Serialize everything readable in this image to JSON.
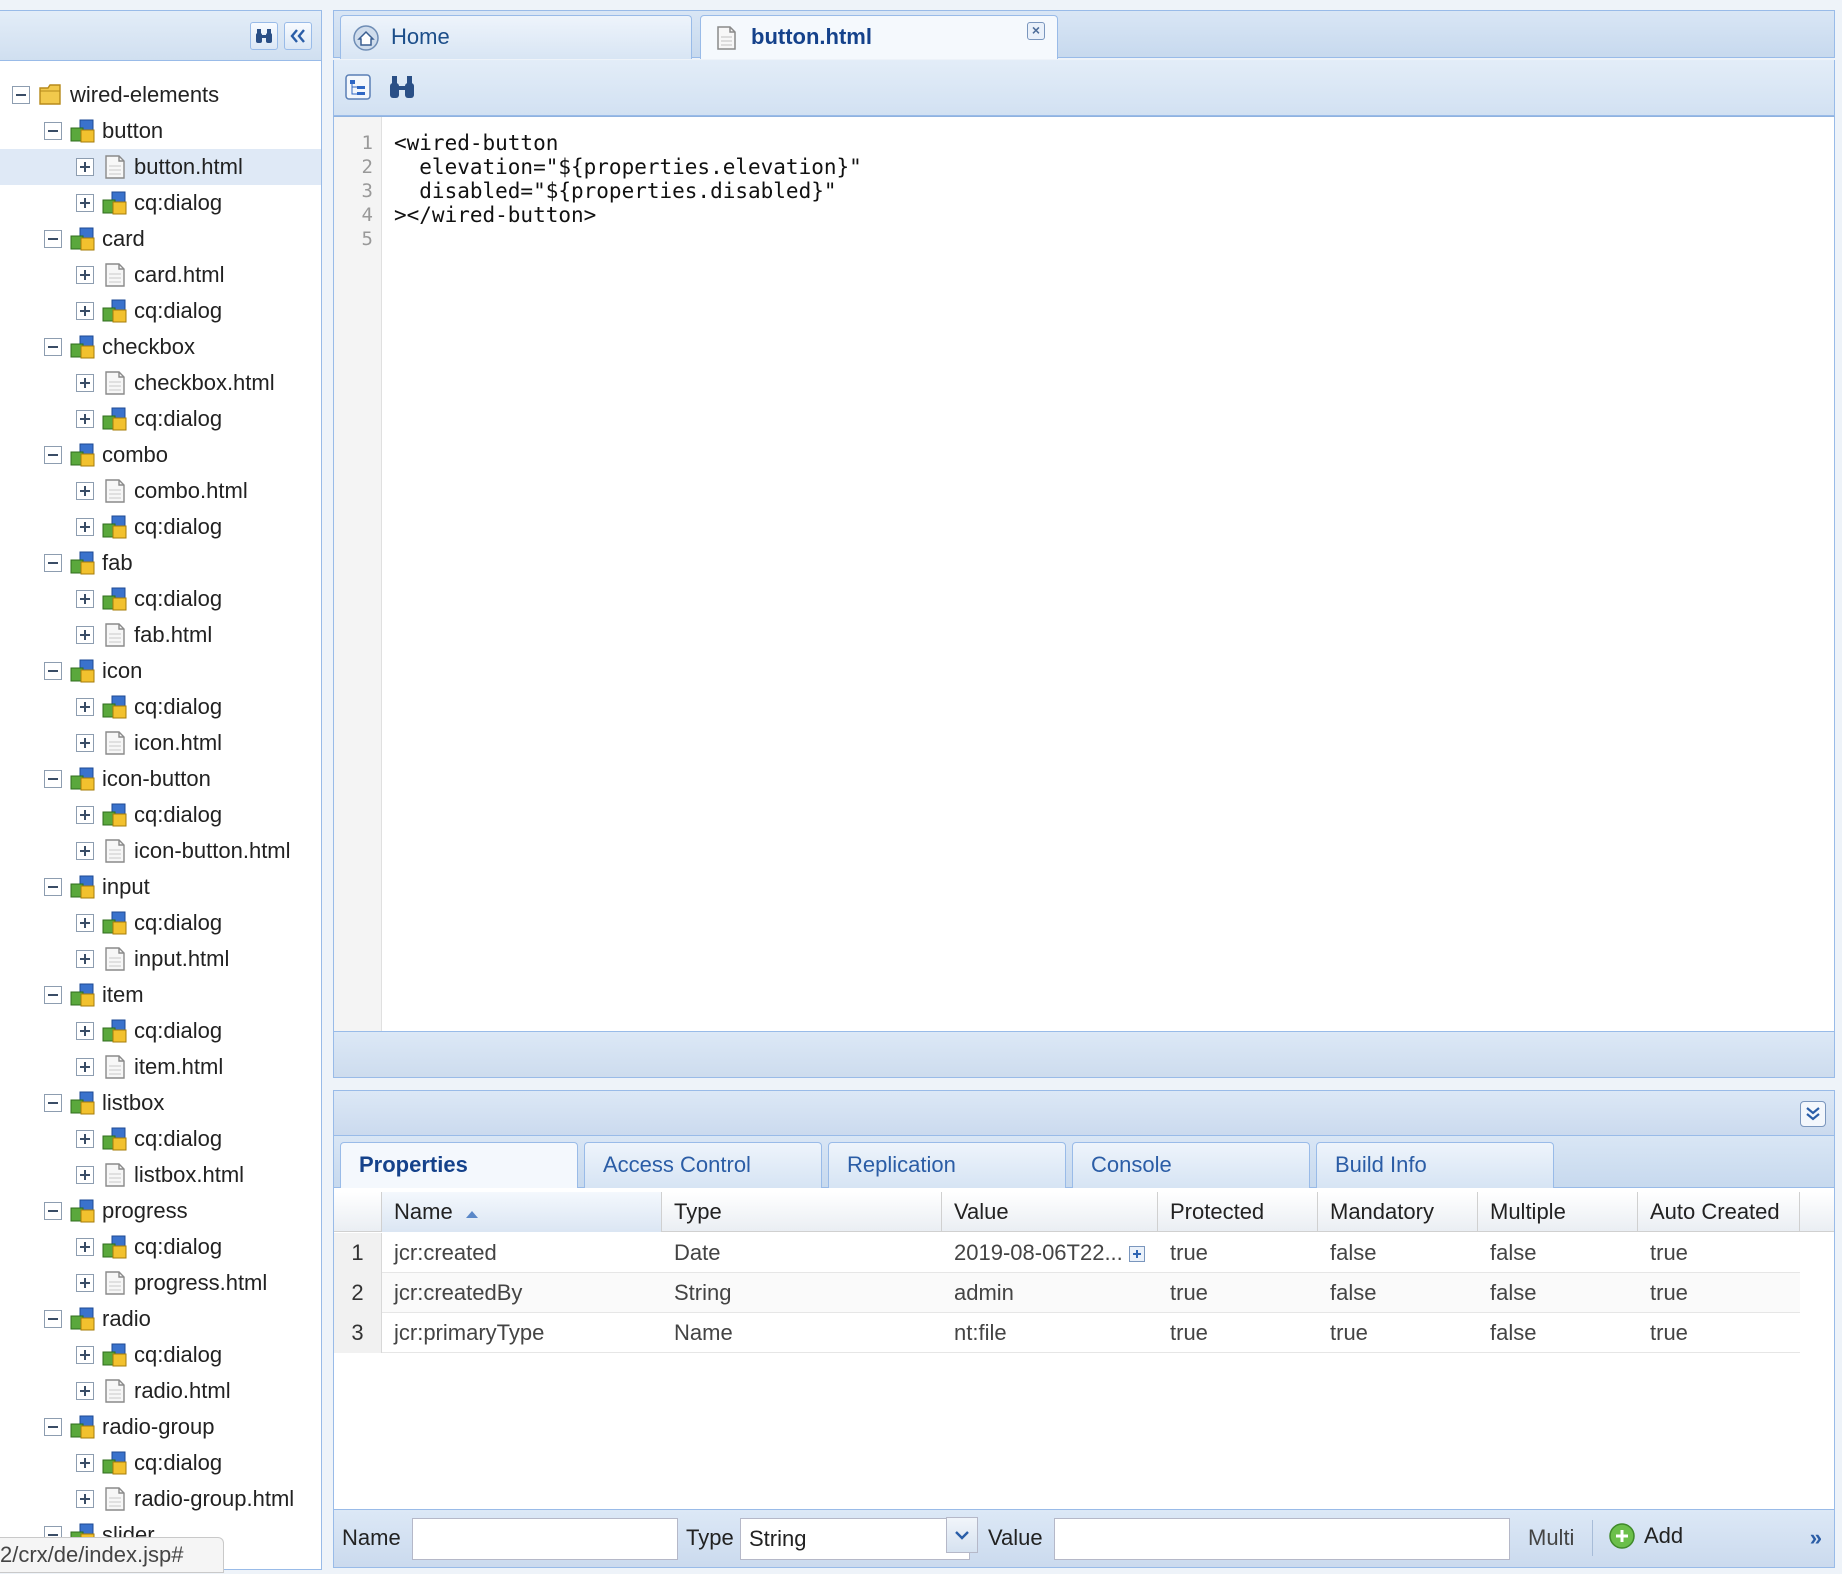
{
  "tree": {
    "items": [
      {
        "label": "wired-elements",
        "level": 0,
        "toggle": "minus",
        "icon": "folder-icon"
      },
      {
        "label": "button",
        "level": 1,
        "toggle": "minus",
        "icon": "component-icon"
      },
      {
        "label": "button.html",
        "level": 2,
        "toggle": "plus",
        "icon": "file-icon",
        "selected": true
      },
      {
        "label": "cq:dialog",
        "level": 2,
        "toggle": "plus",
        "icon": "component-icon"
      },
      {
        "label": "card",
        "level": 1,
        "toggle": "minus",
        "icon": "component-icon"
      },
      {
        "label": "card.html",
        "level": 2,
        "toggle": "plus",
        "icon": "file-icon"
      },
      {
        "label": "cq:dialog",
        "level": 2,
        "toggle": "plus",
        "icon": "component-icon"
      },
      {
        "label": "checkbox",
        "level": 1,
        "toggle": "minus",
        "icon": "component-icon"
      },
      {
        "label": "checkbox.html",
        "level": 2,
        "toggle": "plus",
        "icon": "file-icon"
      },
      {
        "label": "cq:dialog",
        "level": 2,
        "toggle": "plus",
        "icon": "component-icon"
      },
      {
        "label": "combo",
        "level": 1,
        "toggle": "minus",
        "icon": "component-icon"
      },
      {
        "label": "combo.html",
        "level": 2,
        "toggle": "plus",
        "icon": "file-icon"
      },
      {
        "label": "cq:dialog",
        "level": 2,
        "toggle": "plus",
        "icon": "component-icon"
      },
      {
        "label": "fab",
        "level": 1,
        "toggle": "minus",
        "icon": "component-icon"
      },
      {
        "label": "cq:dialog",
        "level": 2,
        "toggle": "plus",
        "icon": "component-icon"
      },
      {
        "label": "fab.html",
        "level": 2,
        "toggle": "plus",
        "icon": "file-icon"
      },
      {
        "label": "icon",
        "level": 1,
        "toggle": "minus",
        "icon": "component-icon"
      },
      {
        "label": "cq:dialog",
        "level": 2,
        "toggle": "plus",
        "icon": "component-icon"
      },
      {
        "label": "icon.html",
        "level": 2,
        "toggle": "plus",
        "icon": "file-icon"
      },
      {
        "label": "icon-button",
        "level": 1,
        "toggle": "minus",
        "icon": "component-icon"
      },
      {
        "label": "cq:dialog",
        "level": 2,
        "toggle": "plus",
        "icon": "component-icon"
      },
      {
        "label": "icon-button.html",
        "level": 2,
        "toggle": "plus",
        "icon": "file-icon"
      },
      {
        "label": "input",
        "level": 1,
        "toggle": "minus",
        "icon": "component-icon"
      },
      {
        "label": "cq:dialog",
        "level": 2,
        "toggle": "plus",
        "icon": "component-icon"
      },
      {
        "label": "input.html",
        "level": 2,
        "toggle": "plus",
        "icon": "file-icon"
      },
      {
        "label": "item",
        "level": 1,
        "toggle": "minus",
        "icon": "component-icon"
      },
      {
        "label": "cq:dialog",
        "level": 2,
        "toggle": "plus",
        "icon": "component-icon"
      },
      {
        "label": "item.html",
        "level": 2,
        "toggle": "plus",
        "icon": "file-icon"
      },
      {
        "label": "listbox",
        "level": 1,
        "toggle": "minus",
        "icon": "component-icon"
      },
      {
        "label": "cq:dialog",
        "level": 2,
        "toggle": "plus",
        "icon": "component-icon"
      },
      {
        "label": "listbox.html",
        "level": 2,
        "toggle": "plus",
        "icon": "file-icon"
      },
      {
        "label": "progress",
        "level": 1,
        "toggle": "minus",
        "icon": "component-icon"
      },
      {
        "label": "cq:dialog",
        "level": 2,
        "toggle": "plus",
        "icon": "component-icon"
      },
      {
        "label": "progress.html",
        "level": 2,
        "toggle": "plus",
        "icon": "file-icon"
      },
      {
        "label": "radio",
        "level": 1,
        "toggle": "minus",
        "icon": "component-icon"
      },
      {
        "label": "cq:dialog",
        "level": 2,
        "toggle": "plus",
        "icon": "component-icon"
      },
      {
        "label": "radio.html",
        "level": 2,
        "toggle": "plus",
        "icon": "file-icon"
      },
      {
        "label": "radio-group",
        "level": 1,
        "toggle": "minus",
        "icon": "component-icon"
      },
      {
        "label": "cq:dialog",
        "level": 2,
        "toggle": "plus",
        "icon": "component-icon"
      },
      {
        "label": "radio-group.html",
        "level": 2,
        "toggle": "plus",
        "icon": "file-icon"
      },
      {
        "label": "slider",
        "level": 1,
        "toggle": "minus",
        "icon": "component-icon"
      }
    ]
  },
  "status_url": "2/crx/de/index.jsp#",
  "editor": {
    "tabs": [
      {
        "label": "Home",
        "icon": "home-icon"
      },
      {
        "label": "button.html",
        "icon": "file-icon",
        "active": true
      }
    ],
    "lines": [
      "<wired-button",
      "  elevation=\"${properties.elevation}\"",
      "  disabled=\"${properties.disabled}\"",
      "></wired-button>",
      ""
    ],
    "line_numbers": [
      "1",
      "2",
      "3",
      "4",
      "5"
    ]
  },
  "bottom": {
    "tabs": [
      "Properties",
      "Access Control",
      "Replication",
      "Console",
      "Build Info"
    ],
    "active_tab": "Properties",
    "columns": [
      "Name",
      "Type",
      "Value",
      "Protected",
      "Mandatory",
      "Multiple",
      "Auto Created"
    ],
    "sorted_column": "Name",
    "rows": [
      {
        "num": "1",
        "name": "jcr:created",
        "type": "Date",
        "value": "2019-08-06T22...",
        "protected": "true",
        "mandatory": "false",
        "multiple": "false",
        "auto_created": "true"
      },
      {
        "num": "2",
        "name": "jcr:createdBy",
        "type": "String",
        "value": "admin",
        "protected": "true",
        "mandatory": "false",
        "multiple": "false",
        "auto_created": "true"
      },
      {
        "num": "3",
        "name": "jcr:primaryType",
        "type": "Name",
        "value": "nt:file",
        "protected": "true",
        "mandatory": "true",
        "multiple": "false",
        "auto_created": "true"
      }
    ]
  },
  "form": {
    "name_label": "Name",
    "name_value": "",
    "type_label": "Type",
    "type_value": "String",
    "value_label": "Value",
    "value_value": "",
    "multi_label": "Multi",
    "add_label": "Add",
    "more_label": "»"
  },
  "colors": {
    "panel_border": "#99bbe8",
    "selected_row": "#dfe9f6",
    "tab_text": "#15428b",
    "component_blue": "#2f67c4",
    "component_green": "#5aa83c",
    "component_yellow": "#f2c12e"
  }
}
